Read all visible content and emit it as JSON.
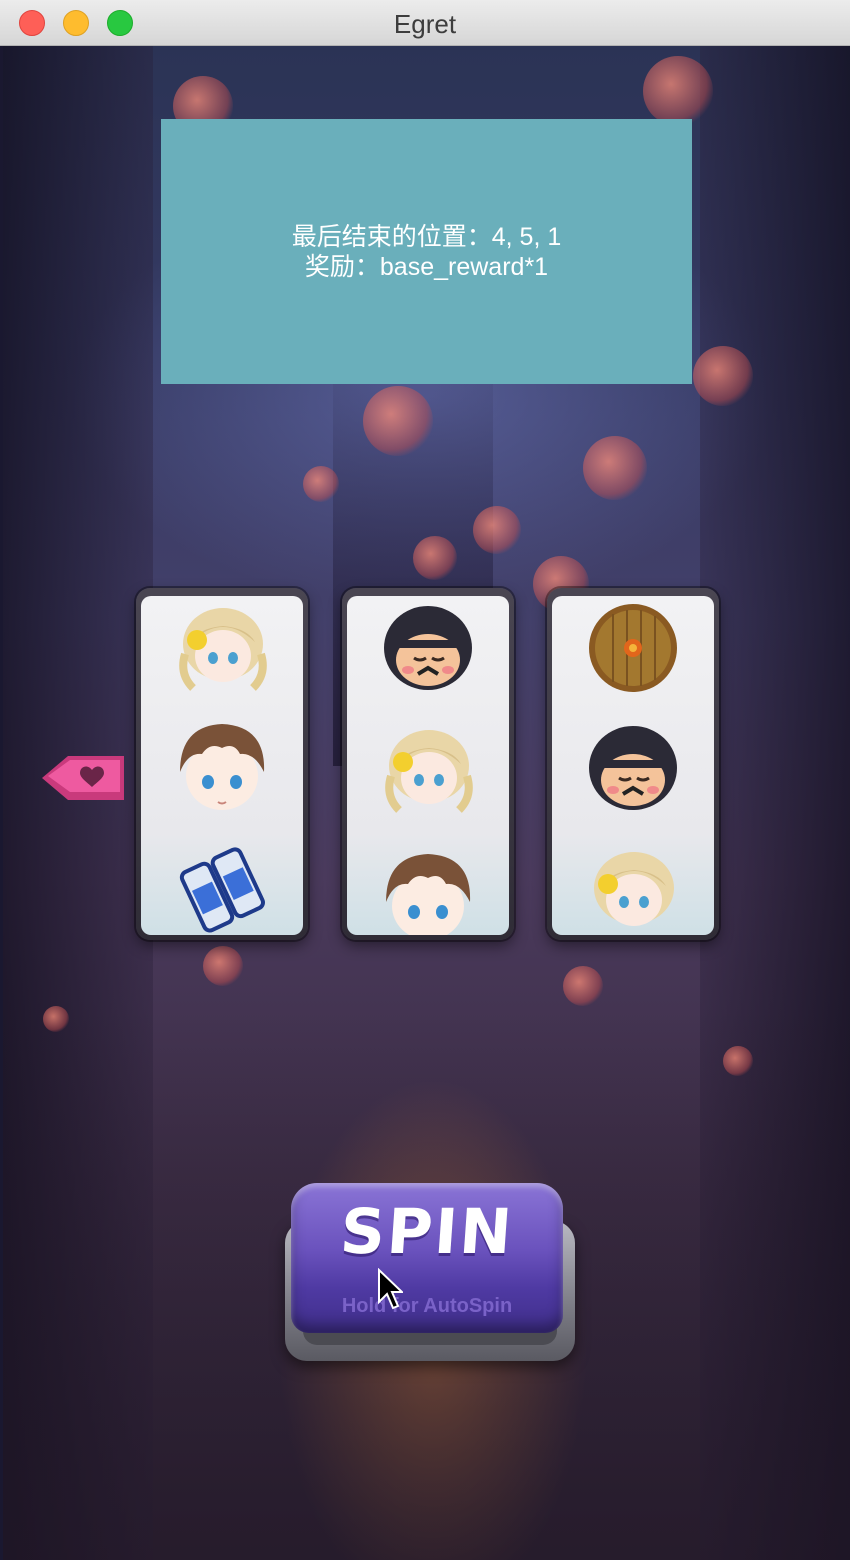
{
  "window": {
    "title": "Egret"
  },
  "panel": {
    "line1": "最后结束的位置：4, 5, 1",
    "line2": "奖励：base_reward*1",
    "color": "#6aafbb"
  },
  "reels": [
    {
      "symbols": [
        "blonde-girl-icon",
        "brown-hair-boy-icon",
        "blue-cans-icon"
      ]
    },
    {
      "symbols": [
        "ninja-icon",
        "blonde-girl-icon",
        "brown-hair-boy-icon"
      ]
    },
    {
      "symbols": [
        "wooden-shield-icon",
        "ninja-icon",
        "blonde-girl-icon"
      ]
    }
  ],
  "pointer": {
    "icon": "pink-heart-arrow-icon",
    "color": "#e5488f"
  },
  "spin_button": {
    "label": "SPIN",
    "sub_label": "Hold for AutoSpin",
    "color": "#6a52bd"
  }
}
